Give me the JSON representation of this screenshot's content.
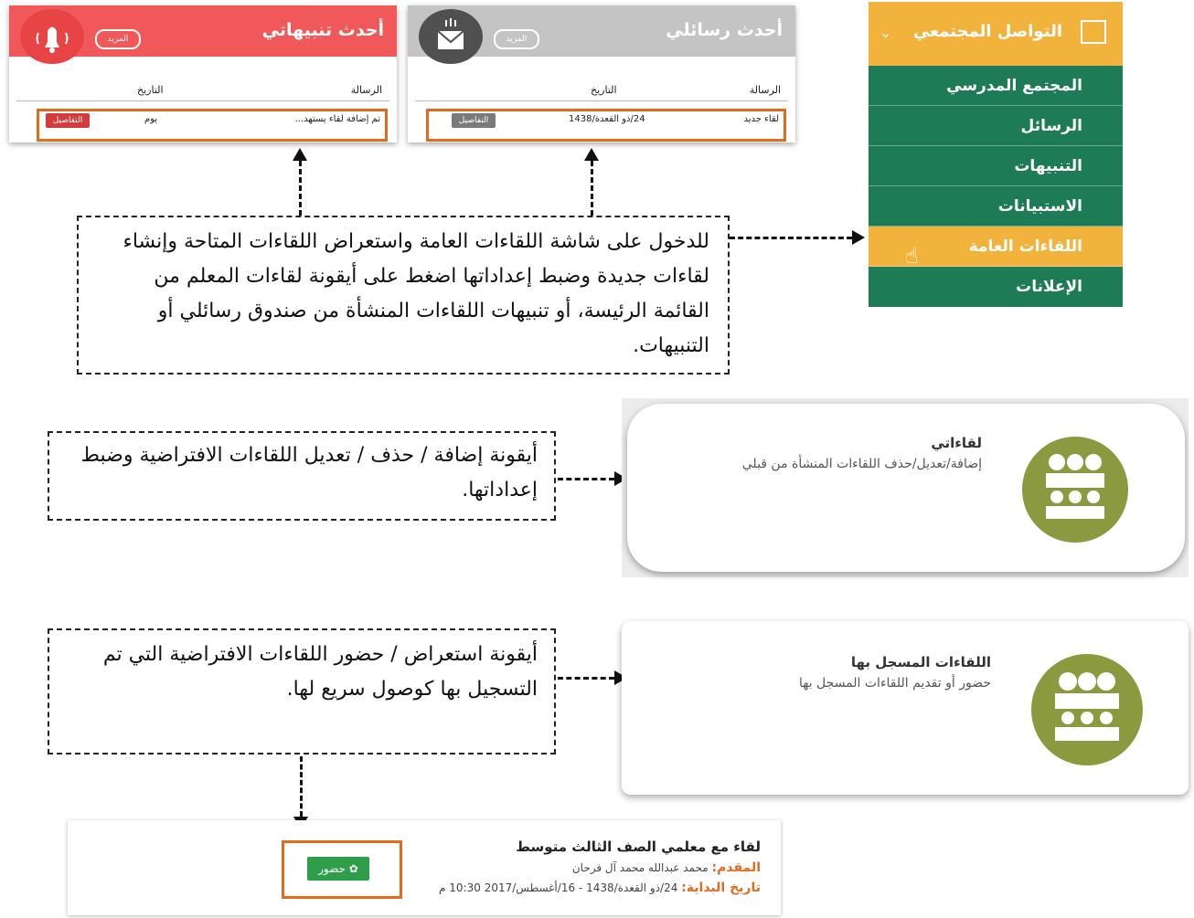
{
  "notifications_panel": {
    "title": "أحدث تنبيهاتي",
    "more_label": "المزيد",
    "col_message": "الرسالة",
    "col_date": "التاريخ",
    "row_message": "تم إضافة لقاء يستهد...",
    "row_date": "يوم",
    "row_button": "التفاصيل",
    "color": "#f0585a"
  },
  "messages_panel": {
    "title": "أحدث رسائلي",
    "more_label": "المزيد",
    "col_message": "الرسالة",
    "col_date": "التاريخ",
    "row_message": "لقاء جديد",
    "row_date": "24/ذو القعدة/1438",
    "row_button": "التفاصيل",
    "color": "#bdbdbd"
  },
  "sidebar": {
    "header": "التواصل المجتمعي",
    "items": [
      {
        "label": "المجتمع المدرسي"
      },
      {
        "label": "الرسائل"
      },
      {
        "label": "التنبيهات"
      },
      {
        "label": "الاستبيانات"
      },
      {
        "label": "اللقاءات العامة"
      },
      {
        "label": "الإعلانات"
      }
    ],
    "header_color": "#f2b33d",
    "green": "#1d7c55"
  },
  "callouts": {
    "main": "للدخول على شاشة اللقاءات العامة واستعراض اللقاءات المتاحة وإنشاء لقاءات جديدة وضبط إعداداتها اضغط على أيقونة لقاءات المعلم من القائمة الرئيسة، أو تنبيهات اللقاءات المنشأة من صندوق رسائلي أو التنبيهات.",
    "my_meetings": "أيقونة إضافة / حذف / تعديل اللقاءات الافتراضية وضبط إعداداتها.",
    "registered": "أيقونة استعراض / حضور اللقاءات الافتراضية التي تم التسجيل بها كوصول سريع لها."
  },
  "card_my_meetings": {
    "title": "لقاءاتي",
    "subtitle": "إضافة/تعديل/حذف اللقاءات المنشأة من قبلي"
  },
  "card_registered": {
    "title": "اللقاءات المسجل بها",
    "subtitle": "حضور أو تقديم اللقاءات المسجل بها"
  },
  "meeting": {
    "title": "لقاء مع معلمي الصف الثالث متوسط",
    "presenter_label": "المقدم:",
    "presenter_value": "محمد عبدالله محمد آل فرحان",
    "start_label": "تاريخ البداية:",
    "start_value": "24/ذو القعدة/1438 - 16/أغسطس/2017 10:30 م",
    "attend_button": "حضور",
    "accent": "#e06a1e",
    "button_color": "#2e9e4a"
  }
}
